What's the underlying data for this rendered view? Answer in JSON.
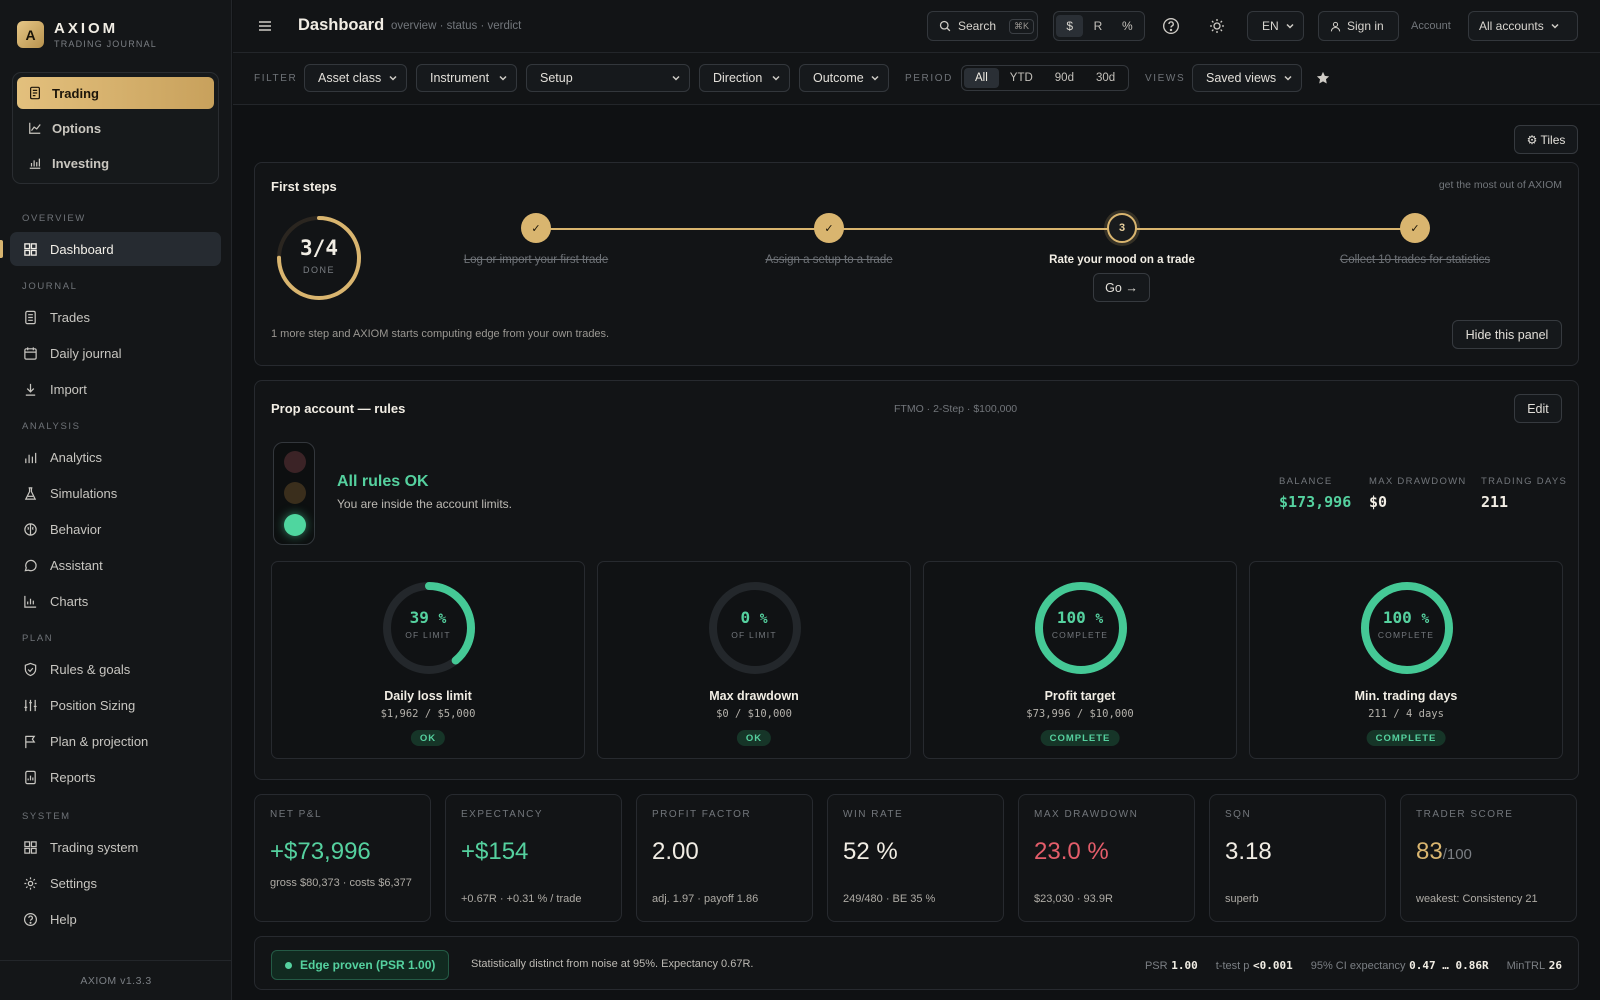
{
  "brand": {
    "letter": "A",
    "name": "AXIOM",
    "subtitle": "TRADING JOURNAL"
  },
  "modes": [
    {
      "label": "Trading",
      "icon": "file-text-icon"
    },
    {
      "label": "Options",
      "icon": "line-chart-icon"
    },
    {
      "label": "Investing",
      "icon": "bar-chart-icon"
    }
  ],
  "sidebar": {
    "overview_label": "OVERVIEW",
    "journal_label": "JOURNAL",
    "analysis_label": "ANALYSIS",
    "plan_label": "PLAN",
    "system_label": "SYSTEM",
    "overview": [
      {
        "label": "Dashboard"
      }
    ],
    "journal": [
      {
        "label": "Trades"
      },
      {
        "label": "Daily journal"
      },
      {
        "label": "Import"
      }
    ],
    "analysis": [
      {
        "label": "Analytics"
      },
      {
        "label": "Simulations"
      },
      {
        "label": "Behavior"
      },
      {
        "label": "Assistant"
      },
      {
        "label": "Charts"
      }
    ],
    "plan": [
      {
        "label": "Rules & goals"
      },
      {
        "label": "Position Sizing"
      },
      {
        "label": "Plan & projection"
      },
      {
        "label": "Reports"
      }
    ],
    "system": [
      {
        "label": "Trading system"
      },
      {
        "label": "Settings"
      },
      {
        "label": "Help"
      }
    ],
    "version": "AXIOM v1.3.3"
  },
  "header": {
    "title": "Dashboard",
    "crumb": "overview · status · verdict",
    "search_label": "Search",
    "search_kbd": "⌘K",
    "units": [
      "$",
      "R",
      "%"
    ],
    "lang": "EN",
    "signin": "Sign in",
    "account_label": "Account",
    "account_value": "All accounts"
  },
  "filters": {
    "filter_label": "FILTER",
    "asset_class": "Asset class",
    "instrument": "Instrument",
    "setup": "Setup",
    "direction": "Direction",
    "outcome": "Outcome",
    "period_label": "PERIOD",
    "periods": [
      "All",
      "YTD",
      "90d",
      "30d"
    ],
    "views_label": "VIEWS",
    "saved_views": "Saved views"
  },
  "tiles_button": "⚙ Tiles",
  "first_steps": {
    "title": "First steps",
    "hint": "get the most out of AXIOM",
    "progress": "3/4",
    "progress_label": "DONE",
    "progress_fraction": 0.75,
    "steps": [
      {
        "num": "✓",
        "label": "Log or import your first trade",
        "done": true
      },
      {
        "num": "✓",
        "label": "Assign a setup to a trade",
        "done": true
      },
      {
        "num": "3",
        "label": "Rate your mood on a trade",
        "done": false
      },
      {
        "num": "✓",
        "label": "Collect 10 trades for statistics",
        "done": true
      }
    ],
    "go_button": "Go →",
    "footer": "1 more step and AXIOM starts computing edge from your own trades.",
    "hide_button": "Hide this panel"
  },
  "prop": {
    "title": "Prop account — rules",
    "meta": "FTMO · 2-Step · $100,000",
    "edit_button": "Edit",
    "status_title": "All rules OK",
    "status_sub": "You are inside the account limits.",
    "stats": [
      {
        "label": "BALANCE",
        "value": "$173,996"
      },
      {
        "label": "MAX DRAWDOWN",
        "value": "$0"
      },
      {
        "label": "TRADING DAYS",
        "value": "211"
      }
    ],
    "rules": [
      {
        "value": "39",
        "unit": "%",
        "caption": "OF LIMIT",
        "fraction": 0.39,
        "title": "Daily loss limit",
        "detail": "$1,962 / $5,000",
        "badge": "OK"
      },
      {
        "value": "0",
        "unit": "%",
        "caption": "OF LIMIT",
        "fraction": 0,
        "title": "Max drawdown",
        "detail": "$0 / $10,000",
        "badge": "OK"
      },
      {
        "value": "100",
        "unit": "%",
        "caption": "COMPLETE",
        "fraction": 1,
        "title": "Profit target",
        "detail": "$73,996 / $10,000",
        "badge": "COMPLETE"
      },
      {
        "value": "100",
        "unit": "%",
        "caption": "COMPLETE",
        "fraction": 1,
        "title": "Min. trading days",
        "detail": "211 / 4 days",
        "badge": "COMPLETE"
      }
    ]
  },
  "kpis": [
    {
      "label": "NET P&L",
      "value": "+$73,996",
      "sub": "gross $80,373 · costs $6,377",
      "tone": "green"
    },
    {
      "label": "EXPECTANCY",
      "value": "+$154",
      "sub": "+0.67R · +0.31 % / trade",
      "tone": "green"
    },
    {
      "label": "PROFIT FACTOR",
      "value": "2.00",
      "sub": "adj. 1.97 · payoff 1.86",
      "tone": ""
    },
    {
      "label": "WIN RATE",
      "value": "52 %",
      "sub": "249/480 · BE 35 %",
      "tone": ""
    },
    {
      "label": "MAX DRAWDOWN",
      "value": "23.0 %",
      "sub": "$23,030 · 93.9R",
      "tone": "red"
    },
    {
      "label": "SQN",
      "value": "3.18",
      "sub": "superb",
      "tone": ""
    },
    {
      "label": "TRADER SCORE",
      "value": "83",
      "value_suffix": "/100",
      "sub": "weakest: Consistency 21",
      "tone": "gold"
    }
  ],
  "edge": {
    "badge": "Edge proven (PSR 1.00)",
    "text": "Statistically distinct from noise at 95%. Expectancy 0.67R.",
    "stats": [
      {
        "label": "PSR",
        "value": "1.00"
      },
      {
        "label": "t-test p",
        "value": "<0.001"
      },
      {
        "label": "95% CI expectancy",
        "value": "0.47 … 0.86R"
      },
      {
        "label": "MinTRL",
        "value": "26"
      }
    ]
  }
}
